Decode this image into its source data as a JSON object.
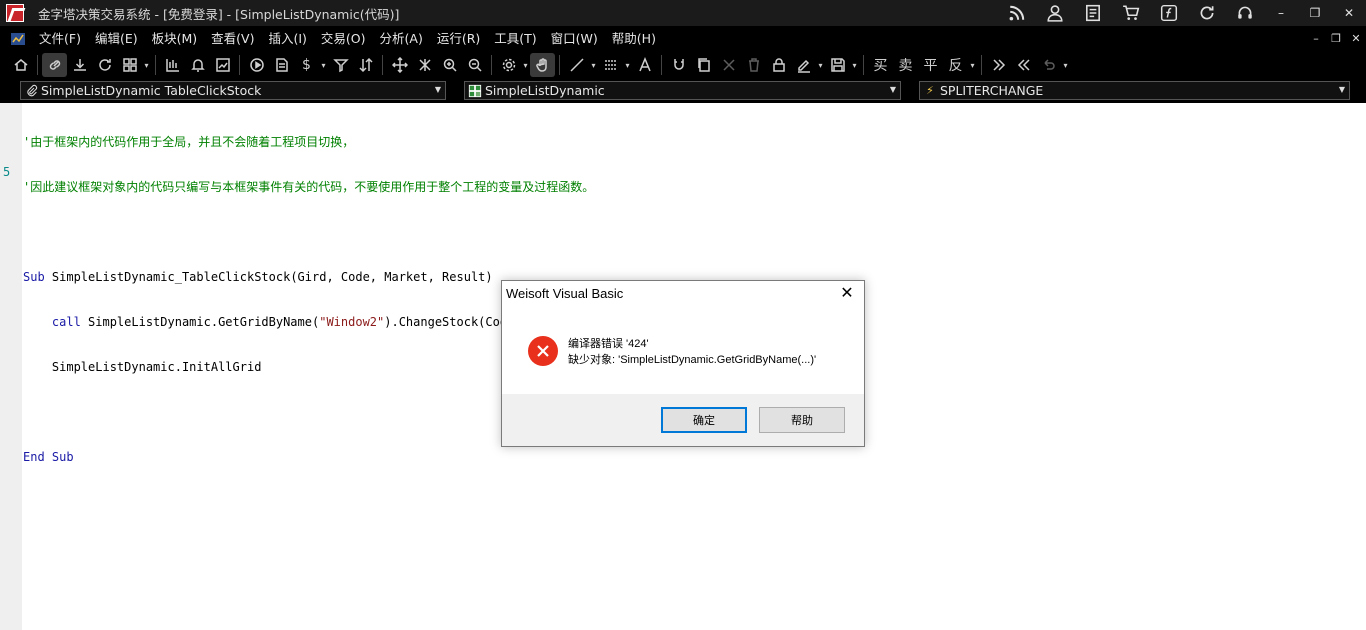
{
  "titlebar": {
    "title": "金字塔决策交易系统 - [免费登录] - [SimpleListDynamic(代码)]",
    "icons": [
      "rss-icon",
      "user-icon",
      "document-icon",
      "cart-icon",
      "function-icon",
      "refresh-icon",
      "headset-icon"
    ],
    "minimize": "–",
    "restore": "❐",
    "close": "✕"
  },
  "menubar": {
    "items": [
      "文件(F)",
      "编辑(E)",
      "板块(M)",
      "查看(V)",
      "插入(I)",
      "交易(O)",
      "分析(A)",
      "运行(R)",
      "工具(T)",
      "窗口(W)",
      "帮助(H)"
    ],
    "win_minimize": "–",
    "win_restore": "❐",
    "win_close": "✕"
  },
  "toolbar": {
    "trade_buttons": [
      "买",
      "卖",
      "平",
      "反"
    ]
  },
  "selectors": {
    "procedure": "SimpleListDynamic TableClickStock",
    "object": "SimpleListDynamic",
    "event": "SPLITERCHANGE"
  },
  "editor": {
    "line_marker": "5",
    "lines": [
      {
        "type": "comment",
        "text": "'由于框架内的代码作用于全局，并且不会随着工程项目切换，"
      },
      {
        "type": "comment",
        "text": "'因此建议框架对象内的代码只编写与本框架事件有关的代码，不要使用作用于整个工程的变量及过程函数。"
      },
      {
        "type": "blank",
        "text": ""
      },
      {
        "type": "sub",
        "kw": "Sub",
        "text": " SimpleListDynamic_TableClickStock(Gird, Code, Market, Result)"
      },
      {
        "type": "call",
        "kw": "    call",
        "pre": " SimpleListDynamic.GetGridByName(",
        "str": "\"Window2\"",
        "post": ").ChangeStock(Code,Market)"
      },
      {
        "type": "plain",
        "text": "    SimpleListDynamic.InitAllGrid"
      },
      {
        "type": "blank",
        "text": ""
      },
      {
        "type": "endsub",
        "kw": "End Sub",
        "text": ""
      }
    ]
  },
  "dialog": {
    "title": "Weisoft Visual Basic",
    "close": "✕",
    "message_line1": "编译器错误 '424'",
    "message_line2": "缺少对象: 'SimpleListDynamic.GetGridByName(...)'",
    "ok_label": "确定",
    "help_label": "帮助"
  },
  "colors": {
    "chrome_bg": "#000000",
    "comment": "#008000",
    "keyword": "#1a1aa6",
    "string": "#8b1a1a",
    "error": "#e8301c",
    "focus": "#0078d7"
  }
}
